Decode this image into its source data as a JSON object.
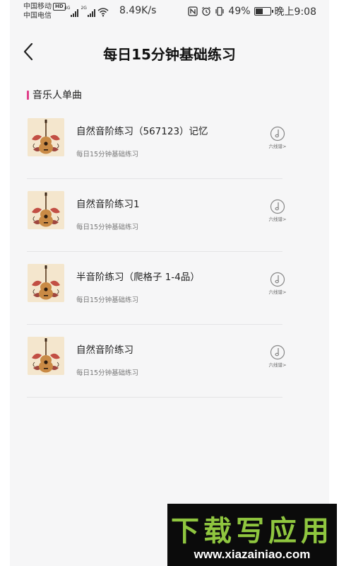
{
  "status_bar": {
    "carrier1": "中国移动",
    "carrier1_badge": "HD",
    "carrier2": "中国电信",
    "net1": "4G",
    "net2": "2G",
    "speed": "8.49K/s",
    "battery_pct": "49%",
    "battery_level": 0.49,
    "time": "晚上9:08"
  },
  "header": {
    "title": "每日15分钟基础练习"
  },
  "section": {
    "title": "音乐人单曲"
  },
  "songs": [
    {
      "title": "自然音阶练习（567123）记忆",
      "subtitle": "每日15分钟基础练习",
      "tab_label": "六线谱>"
    },
    {
      "title": "自然音阶练习1",
      "subtitle": "每日15分钟基础练习",
      "tab_label": "六线谱>"
    },
    {
      "title": "半音阶练习（爬格子 1-4品）",
      "subtitle": "每日15分钟基础练习",
      "tab_label": "六线谱>"
    },
    {
      "title": "自然音阶练习",
      "subtitle": "每日15分钟基础练习",
      "tab_label": "六线谱>"
    }
  ],
  "watermark": {
    "logo": "下载写应用",
    "url": "www.xiazainiao.com"
  },
  "colors": {
    "accent": "#e0408a",
    "background": "#f6f6f7",
    "watermark_green": "#8fc63f"
  }
}
